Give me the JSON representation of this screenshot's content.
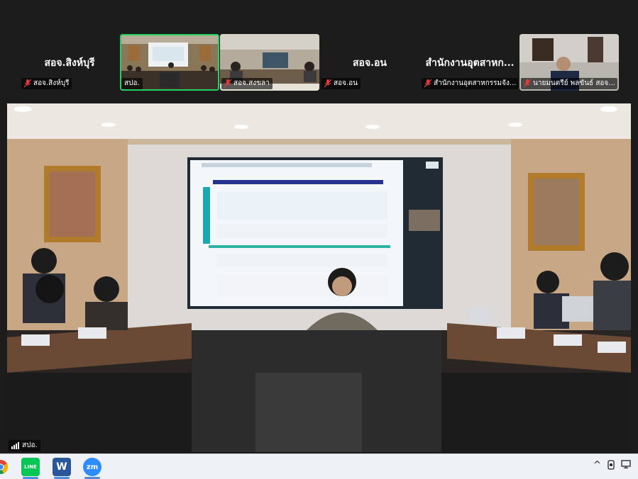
{
  "thumbnails": [
    {
      "display_name": "สอจ.สิงห์บุรี",
      "label": "สอจ.สิงห์บุรี",
      "muted": true,
      "video": false,
      "active": false
    },
    {
      "display_name": "",
      "label": "สปอ.",
      "muted": false,
      "video": true,
      "active": true
    },
    {
      "display_name": "",
      "label": "สอจ.สงขลา",
      "muted": true,
      "video": true,
      "active": false
    },
    {
      "display_name": "สอจ.อน",
      "label": "สอจ.อน",
      "muted": true,
      "video": false,
      "active": false
    },
    {
      "display_name": "สำนักงานอุตสาหก...",
      "label": "สำนักงานอุตสาหกรรมจัง...",
      "muted": true,
      "video": false,
      "active": false
    },
    {
      "display_name": "",
      "label": "นายมนตรีย์ พลขันธ์ สอจ...",
      "muted": true,
      "video": true,
      "active": false
    }
  ],
  "main_video": {
    "speaker_label": "สปอ.",
    "slide_title": "แผนภาพ Journey Map ของประชาชน",
    "slide_subtitle": "CITIZEN JOURNEY",
    "slide_logo": "กรอ"
  },
  "colors": {
    "active_border": "#23d160",
    "background": "#1c1c1c",
    "taskbar": "#eef1f5"
  },
  "taskbar": {
    "apps": [
      {
        "name": "chrome-icon"
      },
      {
        "name": "line-icon",
        "text": "LINE"
      },
      {
        "name": "word-icon",
        "text": "W"
      },
      {
        "name": "zoom-icon",
        "text": "zm"
      }
    ],
    "tray": {
      "chevron": "^"
    }
  }
}
